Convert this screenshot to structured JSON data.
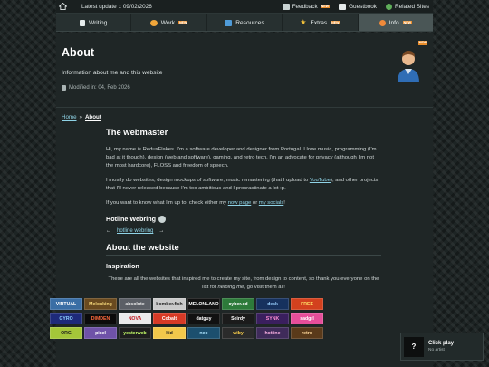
{
  "topbar": {
    "latest_update": "Latest update :: 09/02/2026",
    "feedback": "Feedback",
    "feedback_badge": "NEW",
    "guestbook": "Guestbook",
    "related_sites": "Related Sites"
  },
  "nav": {
    "tabs": [
      {
        "label": "Writing",
        "badge": ""
      },
      {
        "label": "Work",
        "badge": "NEW"
      },
      {
        "label": "Resources",
        "badge": ""
      },
      {
        "label": "Extras",
        "badge": "NEW"
      },
      {
        "label": "Info",
        "badge": "NEW"
      }
    ],
    "active": "Info"
  },
  "hero": {
    "title": "About",
    "subtitle": "Information about me and this website",
    "modified": "Modified in: 04, Feb 2026",
    "badge": "NEW"
  },
  "breadcrumb": {
    "home": "Home",
    "separator": "»",
    "current": "About"
  },
  "webmaster": {
    "heading": "The webmaster",
    "p1": "Hi, my name is ReduxFlakes. I'm a software developer and designer from Portugal. I love music, programming (I'm bad at it though), design (web and software), gaming, and retro tech. I'm an advocate for privacy (although I'm not the most hardcore), FLOSS and freedom of speech.",
    "p2_a": "I mostly do websites, design mockups of software, music remastering (that I upload to ",
    "p2_link": "YouTube",
    "p2_b": "), and other projects that I'll never released because I'm too ambitious and I procrastinate a lot :p.",
    "p3_a": "If you want to know what I'm up to, check either my ",
    "p3_link1": "now page",
    "p3_mid": " or ",
    "p3_link2": "my socials",
    "p3_end": "!"
  },
  "webring": {
    "title": "Hotline Webring",
    "link": "hotline webring",
    "prev": "←",
    "next": "→"
  },
  "about_site": {
    "heading": "About the website",
    "inspiration_heading": "Inspiration",
    "insp_a": "These are all the websites that inspired me to create my site, from design to content, so thank you everyone on the list for ",
    "insp_em": "helping me",
    "insp_b": ", go visit them all!"
  },
  "buttons": [
    {
      "label": "VIRTUAL",
      "bg": "#3a6ea5",
      "fg": "#ffffff"
    },
    {
      "label": "Melonking",
      "bg": "#6a4a1f",
      "fg": "#f5d77a"
    },
    {
      "label": "absolute",
      "bg": "#5b5f66",
      "fg": "#e8e8e8"
    },
    {
      "label": "bomber.fish",
      "bg": "#c9c9c9",
      "fg": "#222222"
    },
    {
      "label": "MELONLAND",
      "bg": "#111111",
      "fg": "#ffffff"
    },
    {
      "label": "cyber.cd",
      "bg": "#2d7a3a",
      "fg": "#ffffff"
    },
    {
      "label": "desk",
      "bg": "#16315e",
      "fg": "#9ad0ff"
    },
    {
      "label": "FREE",
      "bg": "#d3411e",
      "fg": "#ffe066"
    },
    {
      "label": "GYRO",
      "bg": "#1e2a7a",
      "fg": "#8fd3ff"
    },
    {
      "label": "DIMDEN",
      "bg": "#0b0b0b",
      "fg": "#ff6a3d"
    },
    {
      "label": "NOVA",
      "bg": "#eaeaea",
      "fg": "#c0171d"
    },
    {
      "label": "Cobalt",
      "bg": "#d63a26",
      "fg": "#ffffff"
    },
    {
      "label": "datguy",
      "bg": "#111111",
      "fg": "#ffffff"
    },
    {
      "label": "Seirdy",
      "bg": "#1b1b1b",
      "fg": "#ffffff"
    },
    {
      "label": "SYNK",
      "bg": "#3a1f5e",
      "fg": "#ff8fd3"
    },
    {
      "label": "sadgrl",
      "bg": "#e64e9a",
      "fg": "#ffffff"
    },
    {
      "label": "ORG",
      "bg": "#a4c639",
      "fg": "#1b1b1b"
    },
    {
      "label": "pixel",
      "bg": "#6f52a8",
      "fg": "#ffffff"
    },
    {
      "label": "yesterweb",
      "bg": "#1e1e1e",
      "fg": "#c6ff6a"
    },
    {
      "label": "kid",
      "bg": "#f2c84b",
      "fg": "#1b1b1b"
    },
    {
      "label": "neo",
      "bg": "#1c4f6e",
      "fg": "#aee6ff"
    },
    {
      "label": "wiby",
      "bg": "#2b2b2b",
      "fg": "#ffd24a"
    },
    {
      "label": "hotline",
      "bg": "#3f2b5a",
      "fg": "#ffb3e6"
    },
    {
      "label": "retro",
      "bg": "#5a3a1a",
      "fg": "#ffd89a"
    }
  ],
  "player": {
    "title": "Click play",
    "artist": "No artist",
    "icon": "?"
  }
}
